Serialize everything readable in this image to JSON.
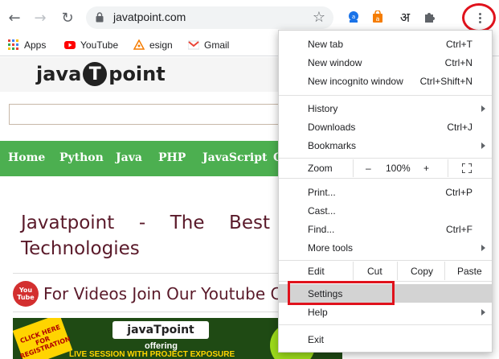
{
  "toolbar": {
    "url": "javatpoint.com",
    "back_glyph": "←",
    "forward_glyph": "→",
    "reload_glyph": "↻",
    "star_glyph": "☆",
    "extension_hindi_glyph": "अ",
    "icons": [
      "back-arrow-icon",
      "forward-arrow-icon",
      "reload-icon",
      "lock-icon",
      "bookmark-star-icon",
      "extension-icon",
      "puzzle-icon",
      "kebab-menu-icon"
    ]
  },
  "bookmarks": [
    {
      "label": "Apps",
      "icon": "apps-grid-icon"
    },
    {
      "label": "YouTube",
      "icon": "youtube-icon"
    },
    {
      "label": "esign",
      "icon": "esign-icon"
    },
    {
      "label": "Gmail",
      "icon": "gmail-icon"
    }
  ],
  "page": {
    "logo_left": "java",
    "logo_mid": "T",
    "logo_right": "point",
    "nav": [
      "Home",
      "Python",
      "Java",
      "PHP",
      "JavaScript",
      "C"
    ],
    "headline_words": [
      "Javatpoint",
      "-",
      "The",
      "Best"
    ],
    "headline_line2": "Technologies",
    "youtube_text": "For Videos Join Our Youtube C",
    "youtube_badge_top": "You",
    "youtube_badge_bottom": "Tube",
    "banner_burst": "CLICK HERE FOR REGISTRATION",
    "banner_logo": "javaTpoint",
    "banner_offering": "offering",
    "banner_live": "LIVE SESSION WITH PROJECT EXPOSURE"
  },
  "menu": {
    "new_tab": {
      "label": "New tab",
      "shortcut": "Ctrl+T"
    },
    "new_window": {
      "label": "New window",
      "shortcut": "Ctrl+N"
    },
    "new_incognito": {
      "label": "New incognito window",
      "shortcut": "Ctrl+Shift+N"
    },
    "history": {
      "label": "History"
    },
    "downloads": {
      "label": "Downloads",
      "shortcut": "Ctrl+J"
    },
    "bookmarks": {
      "label": "Bookmarks"
    },
    "zoom": {
      "label": "Zoom",
      "minus": "–",
      "value": "100%",
      "plus": "+"
    },
    "print": {
      "label": "Print...",
      "shortcut": "Ctrl+P"
    },
    "cast": {
      "label": "Cast..."
    },
    "find": {
      "label": "Find...",
      "shortcut": "Ctrl+F"
    },
    "more_tools": {
      "label": "More tools"
    },
    "edit": {
      "label": "Edit",
      "cut": "Cut",
      "copy": "Copy",
      "paste": "Paste"
    },
    "settings": {
      "label": "Settings"
    },
    "help": {
      "label": "Help"
    },
    "exit": {
      "label": "Exit"
    }
  },
  "annotations": {
    "highlight_color": "#e0121c"
  }
}
